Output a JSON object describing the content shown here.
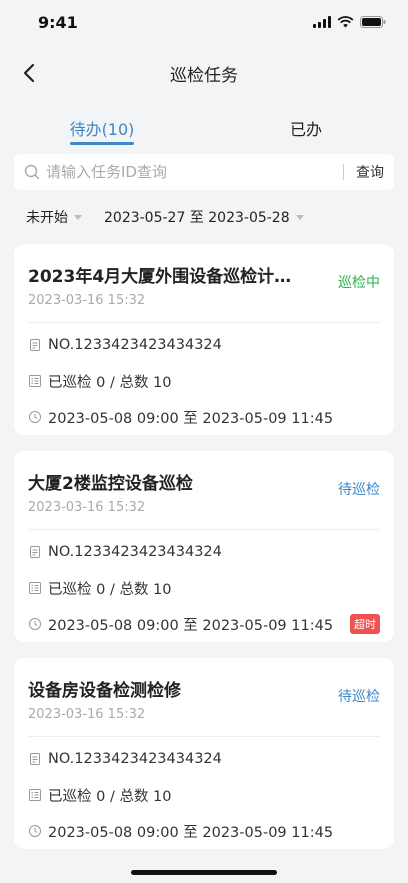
{
  "status_bar": {
    "time": "9:41"
  },
  "nav": {
    "title": "巡检任务"
  },
  "tabs": [
    {
      "label": "待办(10)",
      "active": true
    },
    {
      "label": "已办",
      "active": false
    }
  ],
  "search": {
    "placeholder": "请输入任务ID查询",
    "button": "查询"
  },
  "filter": {
    "status": "未开始",
    "date_range": "2023-05-27 至 2023-05-28"
  },
  "colors": {
    "accent": "#3c88c9",
    "in_progress": "#2bb24c",
    "overtime": "#ef5350"
  },
  "cards": [
    {
      "title": "2023年4月大厦外围设备巡检计划...",
      "date": "2023-03-16 15:32",
      "status": "巡检中",
      "status_color": "#2bb24c",
      "no": "NO.1233423423434324",
      "progress": "已巡检 0 / 总数 10",
      "time_range": "2023-05-08 09:00 至 2023-05-09 11:45",
      "badge": null
    },
    {
      "title": "大厦2楼监控设备巡检",
      "date": "2023-03-16 15:32",
      "status": "待巡检",
      "status_color": "#3c88c9",
      "no": "NO.1233423423434324",
      "progress": "已巡检 0 / 总数 10",
      "time_range": "2023-05-08 09:00 至 2023-05-09 11:45",
      "badge": "超时"
    },
    {
      "title": "设备房设备检测检修",
      "date": "2023-03-16 15:32",
      "status": "待巡检",
      "status_color": "#3c88c9",
      "no": "NO.1233423423434324",
      "progress": "已巡检 0 / 总数 10",
      "time_range": "2023-05-08 09:00 至 2023-05-09 11:45",
      "badge": null
    }
  ]
}
